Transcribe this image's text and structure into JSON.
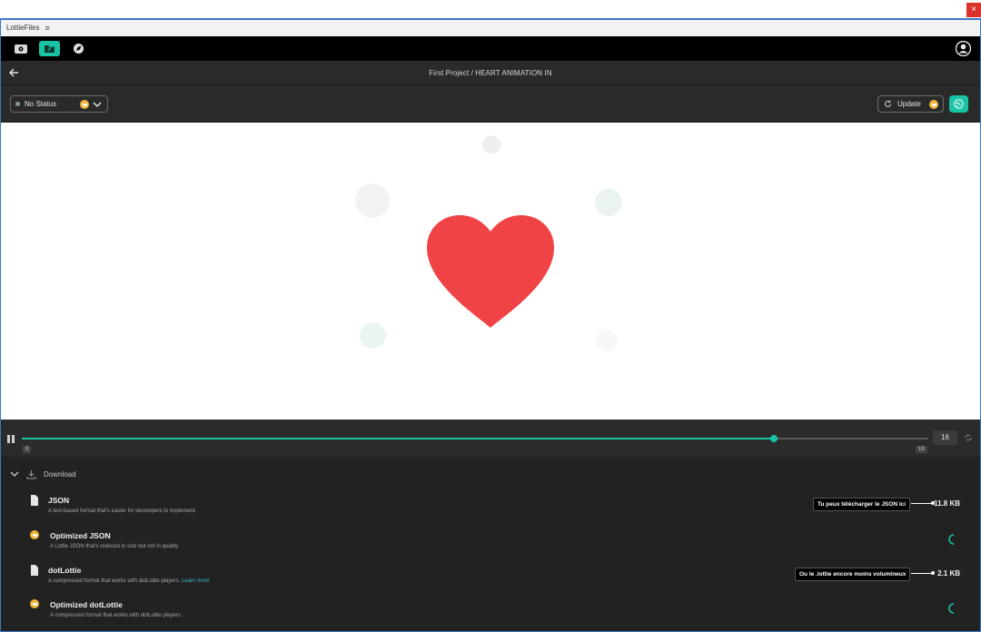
{
  "window": {
    "app_name": "LottieFiles",
    "menu_glyph": "≡",
    "close_glyph": "×"
  },
  "toolbar": {
    "icons": [
      "preview-icon",
      "folder-icon",
      "compass-icon"
    ],
    "active_index": 1
  },
  "nav": {
    "breadcrumb": "First Project / HEART ANIMATION IN"
  },
  "actions": {
    "status_label": "No Status",
    "update_label": "Update"
  },
  "player": {
    "current_frame": "16",
    "start_frame": "0",
    "end_frame": "19",
    "progress": 0.83
  },
  "download": {
    "header": "Download",
    "items": [
      {
        "title": "JSON",
        "description": "A text-based format that's easier for developers to implement.",
        "size": "11.8 KB",
        "icon": "file-icon",
        "annotation": "Tu peux télécharger le JSON ici"
      },
      {
        "title": "Optimized JSON",
        "description": "A Lottie JSON that's reduced in size but not in quality.",
        "icon": "crown-icon"
      },
      {
        "title": "dotLottie",
        "description": "A compressed format that works with dotLottie players.",
        "link": "Learn more",
        "size": "2.1 KB",
        "icon": "file-icon",
        "annotation": "Ou le .lottie encore moins volumineux"
      },
      {
        "title": "Optimized dotLottie",
        "description": "A compressed format that works with dotLottie players.",
        "icon": "crown-icon"
      }
    ]
  },
  "colors": {
    "accent": "#19c4a5",
    "heart": "#ef4346"
  }
}
